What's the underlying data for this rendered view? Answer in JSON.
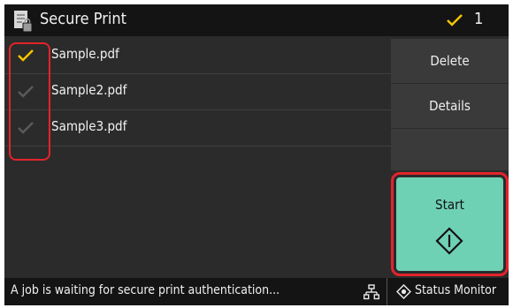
{
  "header": {
    "title": "Secure Print",
    "selected_count": "1",
    "icon": "secure-document-icon"
  },
  "files": [
    {
      "name": "Sample.pdf",
      "checked": true
    },
    {
      "name": "Sample2.pdf",
      "checked": false
    },
    {
      "name": "Sample3.pdf",
      "checked": false
    }
  ],
  "actions": {
    "delete_label": "Delete",
    "details_label": "Details",
    "start_label": "Start"
  },
  "status_bar": {
    "message": "A job is waiting for secure print authentication...",
    "network_icon": "network-icon",
    "status_monitor_label": "Status Monitor"
  },
  "colors": {
    "check_active": "#f5c400",
    "check_inactive": "#5a5a5a",
    "start_button": "#6fd1b4",
    "highlight": "#e3242b"
  }
}
